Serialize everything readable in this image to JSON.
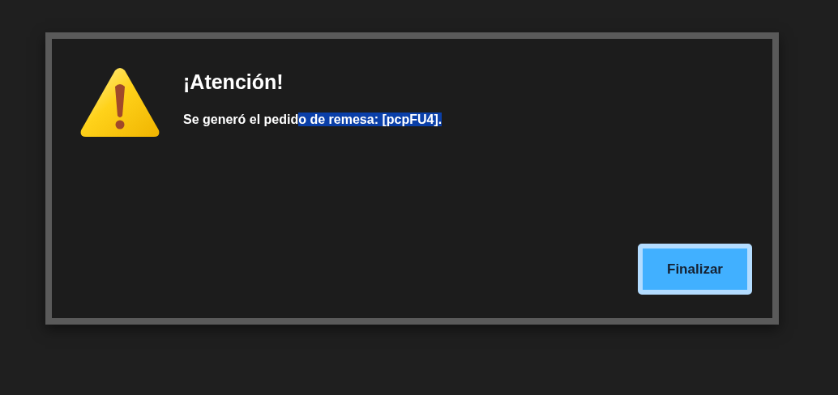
{
  "dialog": {
    "title": "¡Atención!",
    "message": {
      "text": "Se generó el pedid",
      "selected_text": "o de remesa: [pcpFU4]."
    },
    "buttons": [
      {
        "label": "Finalizar",
        "focused": true
      }
    ]
  }
}
